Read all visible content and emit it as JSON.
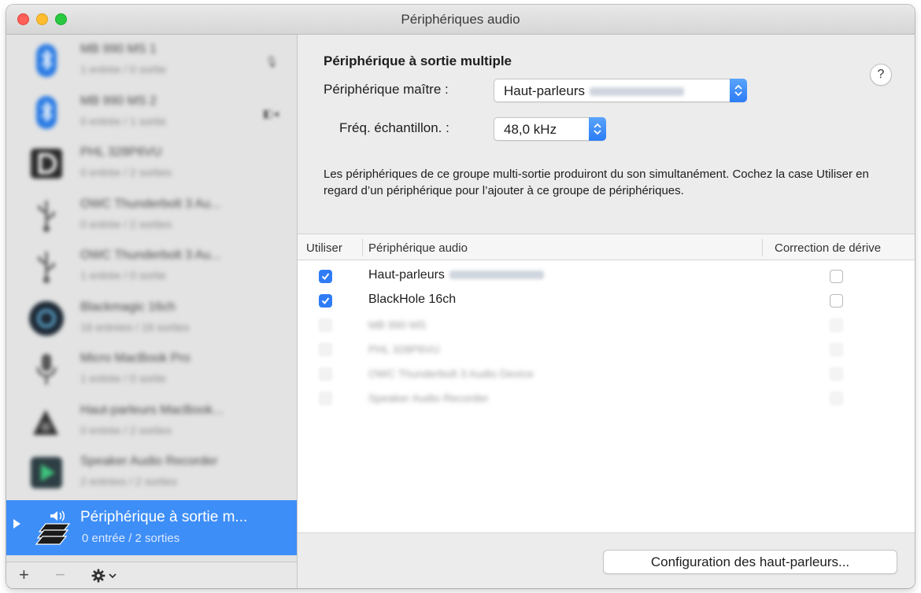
{
  "window": {
    "title": "Périphériques audio"
  },
  "sidebar": {
    "devices": [
      {
        "name": "MB 990 MS 1",
        "sub": "1 entrée / 0 sortie",
        "icon": "bluetooth-icon",
        "extra": ""
      },
      {
        "name": "MB 990 MS 2",
        "sub": "0 entrée / 1 sortie",
        "icon": "bluetooth-icon",
        "extra": "◧◂"
      },
      {
        "name": "PHL 328P6VU",
        "sub": "0 entrée / 2 sorties",
        "icon": "displayport-icon",
        "extra": ""
      },
      {
        "name": "OWC Thunderbolt 3 Au...",
        "sub": "0 entrée / 2 sorties",
        "icon": "usb-icon",
        "extra": ""
      },
      {
        "name": "OWC Thunderbolt 3 Au...",
        "sub": "1 entrée / 0 sortie",
        "icon": "usb-icon",
        "extra": ""
      },
      {
        "name": "Blackmagic 16ch",
        "sub": "16 entrées / 16 sorties",
        "icon": "blackhole-icon",
        "extra": ""
      },
      {
        "name": "Micro MacBook Pro",
        "sub": "1 entrée / 0 sortie",
        "icon": "microphone-icon",
        "extra": ""
      },
      {
        "name": "Haut-parleurs MacBook...",
        "sub": "0 entrée / 2 sorties",
        "icon": "speaker-icon",
        "extra": ""
      },
      {
        "name": "Speaker Audio Recorder",
        "sub": "2 entrées / 2 sorties",
        "icon": "app-icon",
        "extra": ""
      }
    ],
    "selected": {
      "name": "Périphérique à sortie m...",
      "sub": "0 entrée / 2 sorties"
    },
    "toolbar": {
      "add": "+",
      "remove": "−",
      "gear": "✱⌄"
    }
  },
  "main": {
    "title": "Périphérique à sortie multiple",
    "help_label": "?",
    "master_label": "Périphérique maître :",
    "master_value": "Haut-parleurs",
    "freq_label": "Fréq. échantillon. :",
    "freq_value": "48,0 kHz",
    "description": "Les périphériques de ce groupe multi-sortie produiront du son simultanément. Cochez la case Utiliser en regard d’un périphérique pour l’ajouter à ce groupe de périphériques.",
    "table": {
      "headers": {
        "use": "Utiliser",
        "device": "Périphérique audio",
        "drift": "Correction de dérive"
      },
      "rows": [
        {
          "name": "Haut-parleurs",
          "checked": true,
          "drift": false
        },
        {
          "name": "BlackHole 16ch",
          "checked": true,
          "drift": false
        },
        {
          "name": "MB 990 MS",
          "checked": false,
          "drift": false
        },
        {
          "name": "PHL 328P6VU",
          "checked": false,
          "drift": false
        },
        {
          "name": "OWC Thunderbolt 3 Audio Device",
          "checked": false,
          "drift": false
        },
        {
          "name": "Speaker Audio Recorder",
          "checked": false,
          "drift": false
        }
      ]
    },
    "config_button": "Configuration des haut-parleurs..."
  },
  "colors": {
    "accent": "#3e8ef7",
    "checkbox": "#2f7cf6",
    "sidebar": "#e3e3e3"
  }
}
